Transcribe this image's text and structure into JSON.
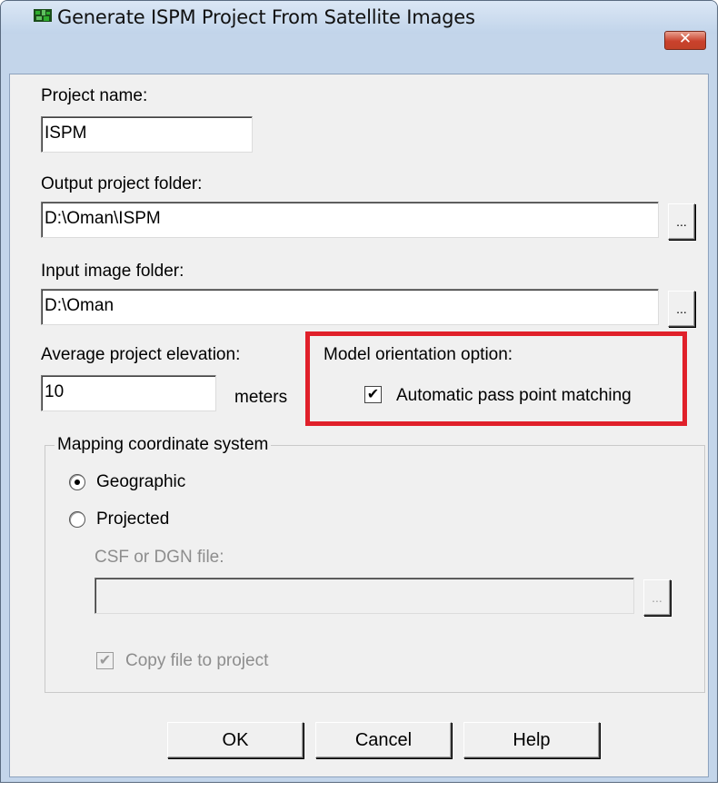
{
  "window": {
    "title": "Generate ISPM Project From Satellite Images",
    "icon": "ispm-app-icon",
    "close_glyph": "✕"
  },
  "project_name": {
    "label": "Project name:",
    "value": "ISPM"
  },
  "output_folder": {
    "label": "Output project folder:",
    "value": "D:\\Oman\\ISPM",
    "browse_label": "..."
  },
  "input_folder": {
    "label": "Input image folder:",
    "value": "D:\\Oman",
    "browse_label": "..."
  },
  "elevation": {
    "label": "Average project elevation:",
    "value": "10",
    "unit": "meters"
  },
  "model_orientation": {
    "label": "Model orientation option:",
    "auto_match": {
      "label": "Automatic pass point matching",
      "checked": true,
      "glyph": "✔"
    }
  },
  "mapping": {
    "group_title": "Mapping coordinate system",
    "geographic": {
      "label": "Geographic",
      "selected": true
    },
    "projected": {
      "label": "Projected",
      "selected": false
    },
    "csf_label": "CSF or DGN file:",
    "csf_value": "",
    "csf_browse_label": "...",
    "copy_file": {
      "label": "Copy file to project",
      "checked": true,
      "glyph": "✔"
    }
  },
  "buttons": {
    "ok": "OK",
    "cancel": "Cancel",
    "help": "Help"
  },
  "colors": {
    "highlight": "#e0202a",
    "dialog_bg": "#f0f0f0",
    "frame": "#c3d5ea"
  }
}
